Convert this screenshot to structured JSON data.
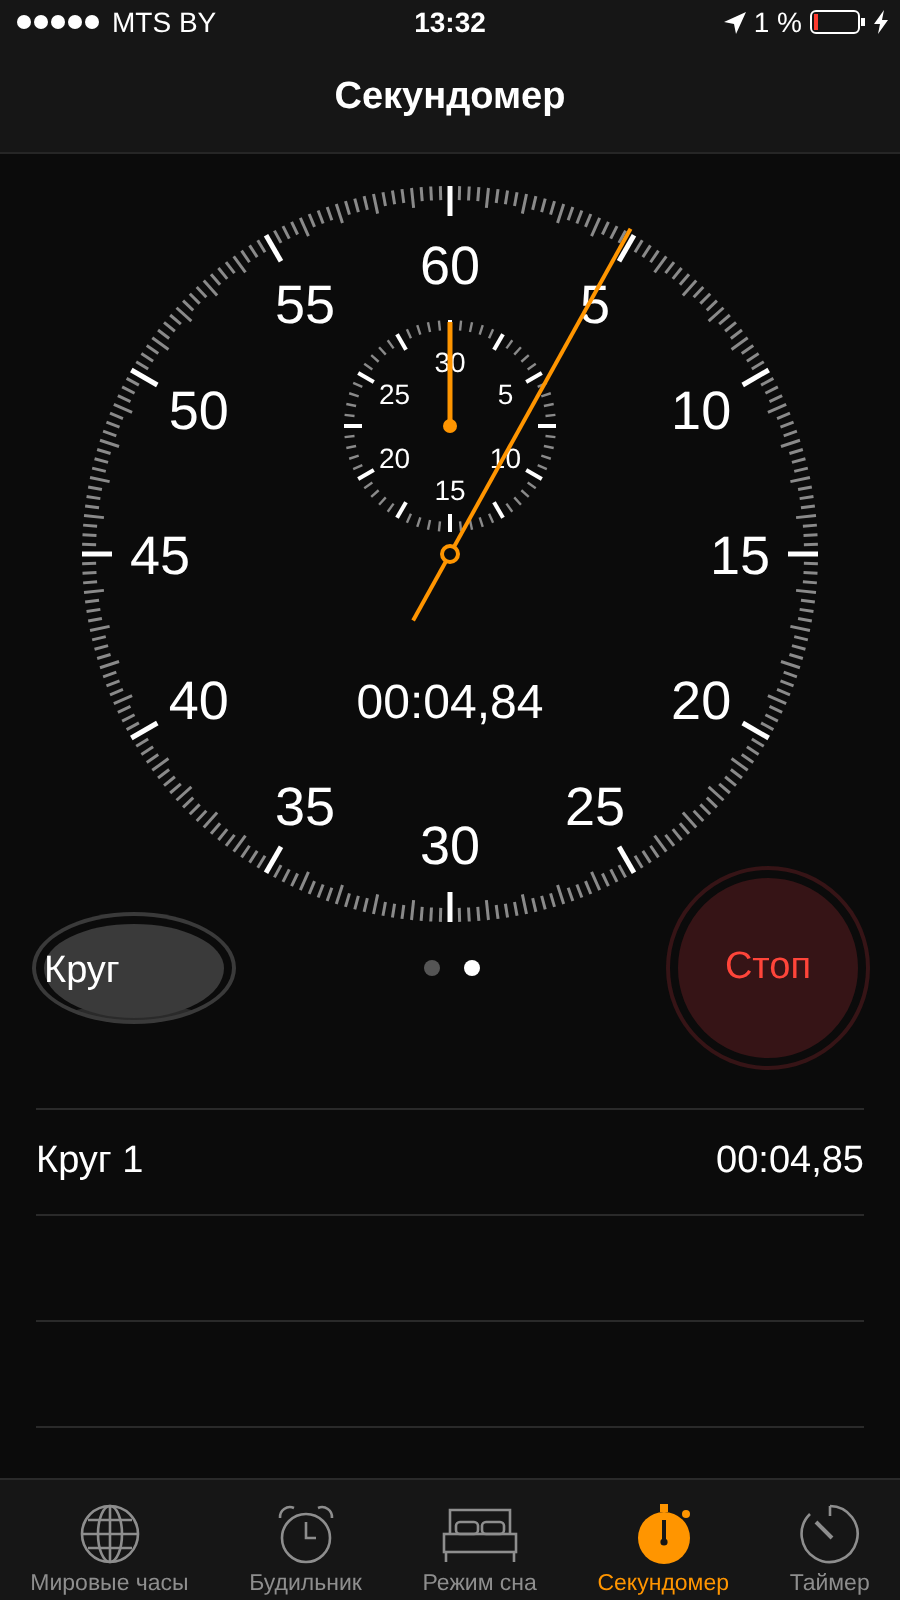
{
  "status_bar": {
    "carrier": "MTS BY",
    "time": "13:32",
    "battery": "1 %"
  },
  "nav_bar": {
    "title": "Секундомер"
  },
  "dial": {
    "labels": [
      "60",
      "5",
      "10",
      "15",
      "20",
      "25",
      "30",
      "35",
      "40",
      "45",
      "50",
      "55"
    ],
    "sub_labels": [
      "30",
      "5",
      "10",
      "15",
      "20",
      "25"
    ],
    "time": "00:04,84"
  },
  "buttons": [
    {
      "label": "Круг",
      "kind": "lap"
    },
    {
      "label": "Стоп",
      "kind": "stop"
    }
  ],
  "pages": [
    {
      "selected": false
    },
    {
      "selected": true
    }
  ],
  "laps": [
    {
      "name": "Круг 1",
      "time": "00:04,85"
    }
  ],
  "tab_bar": [
    {
      "label": "Мировые часы",
      "selected": false
    },
    {
      "label": "Будильник",
      "selected": false
    },
    {
      "label": "Режим сна",
      "selected": false
    },
    {
      "label": "Секундомер",
      "selected": true
    },
    {
      "label": "Таймер",
      "selected": false
    }
  ]
}
